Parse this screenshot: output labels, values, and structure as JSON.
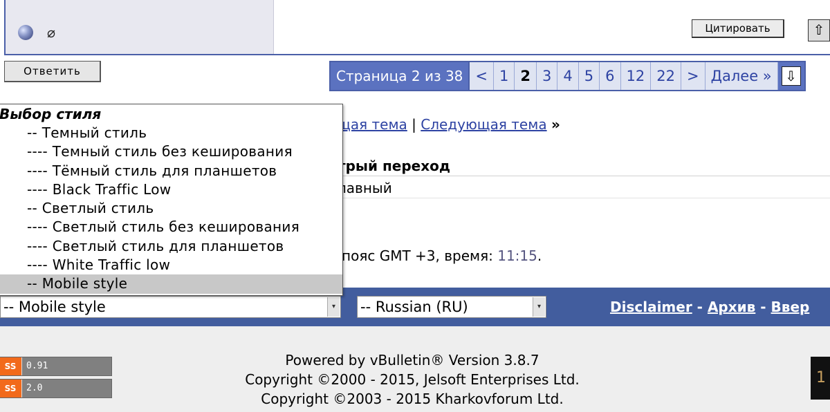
{
  "post": {
    "quote_label": "Цитировать"
  },
  "reply_label": "Ответить",
  "pagination": {
    "info": "Страница 2 из 38",
    "prev": "<",
    "pages": [
      "1",
      "2",
      "3",
      "4",
      "5",
      "6",
      "12",
      "22"
    ],
    "current": "2",
    "next": ">",
    "last": "Далее »"
  },
  "nav": {
    "prev_thread": "щая тема",
    "separator": "|",
    "next_thread": "Следующая тема",
    "arrow": "»"
  },
  "quick_jump": {
    "title": "трый переход",
    "value": "лавный"
  },
  "timezone": {
    "text": "пояс GMT +3, время: ",
    "time": "11:15",
    "end": "."
  },
  "style_dropdown": {
    "group": "Выбор стиля",
    "items": [
      "-- Темный стиль",
      "---- Темный стиль без кеширования",
      "---- Тёмный стиль для планшетов",
      "---- Black Traffic Low",
      "-- Светлый стиль",
      "---- Светлый стиль без кеширования",
      "---- Светлый стиль для планшетов",
      "---- White Traffic low",
      "-- Mobile style"
    ],
    "selected": "-- Mobile style"
  },
  "language_select": {
    "value": "-- Russian (RU)"
  },
  "footer_links": {
    "disclaimer": "Disclaimer",
    "sep1": " - ",
    "archive": "Архив",
    "sep2": " - ",
    "top": "Ввер"
  },
  "rss": [
    {
      "tag": "SS",
      "version": "0.91"
    },
    {
      "tag": "SS",
      "version": "2.0"
    }
  ],
  "credits": [
    "Powered by vBulletin® Version 3.8.7",
    "Copyright ©2000 - 2015, Jelsoft Enterprises Ltd.",
    "Copyright ©2003 - 2015 Kharkovforum Ltd."
  ],
  "colors": {
    "accent": "#4a5fa8",
    "footer": "#425d9e",
    "link": "#2e43a3",
    "rss": "#f26a1b"
  }
}
